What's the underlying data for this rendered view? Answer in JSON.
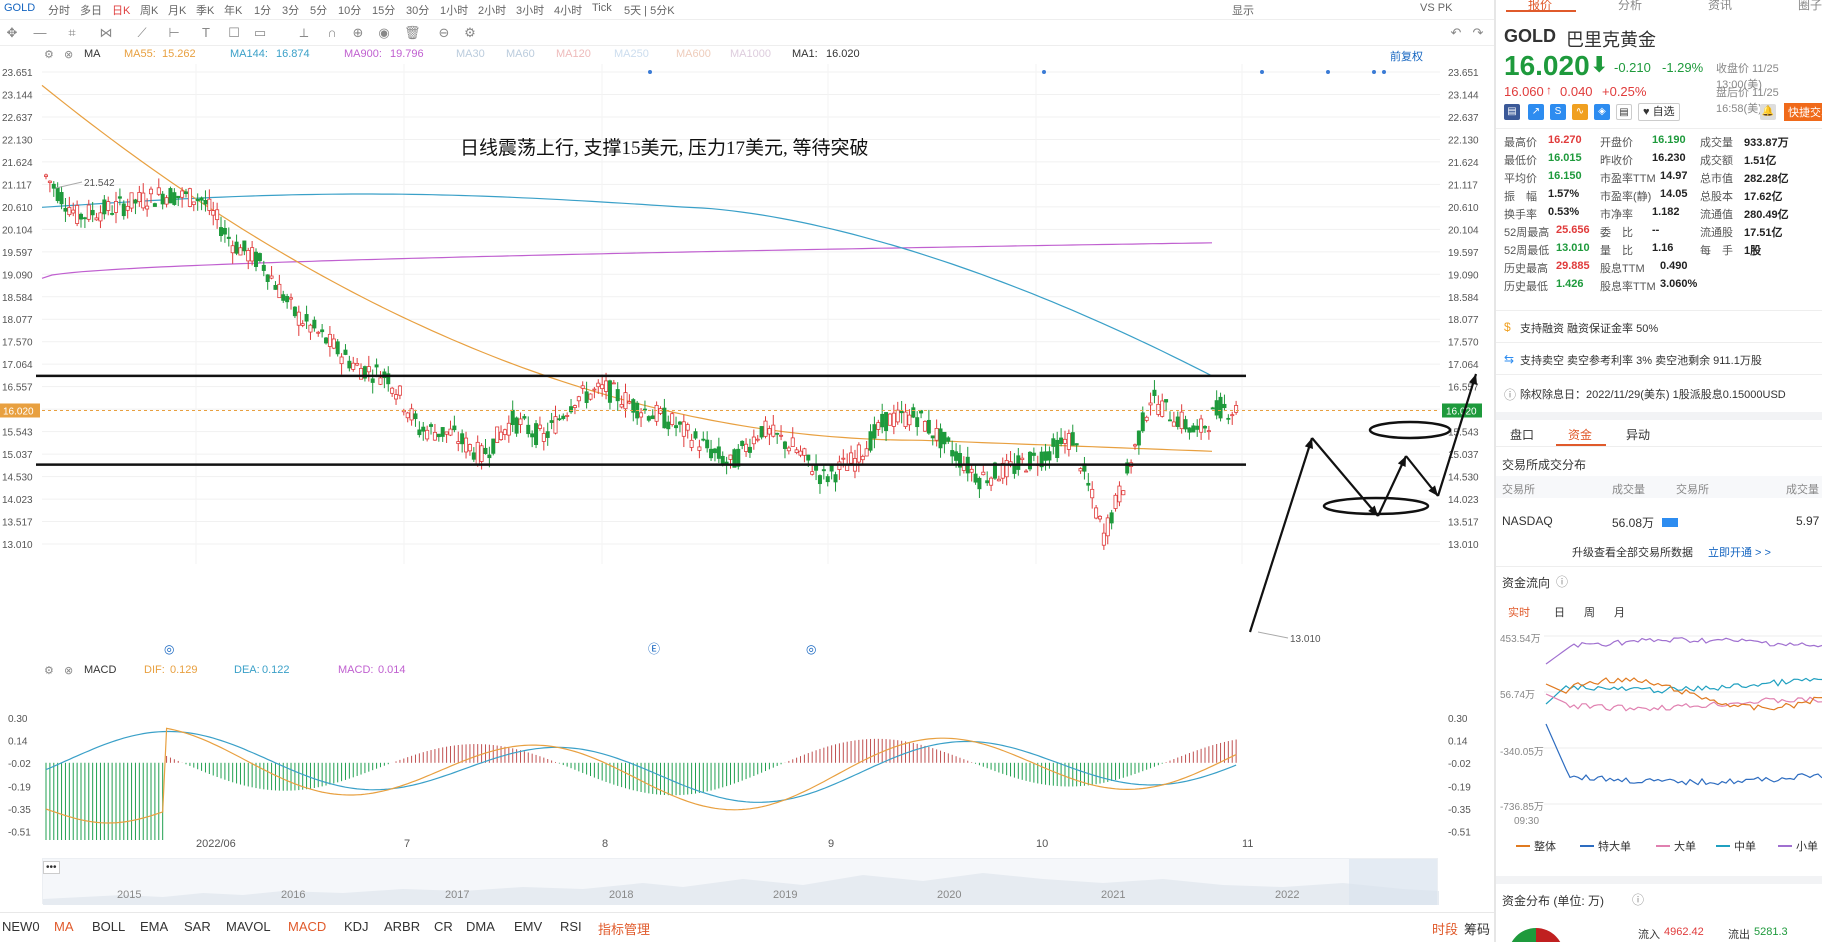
{
  "topbar": {
    "symbol": "GOLD",
    "periods": [
      "分时",
      "多日",
      "日K",
      "周K",
      "月K",
      "季K",
      "年K",
      "1分",
      "3分",
      "5分",
      "10分",
      "15分",
      "30分",
      "1小时",
      "2小时",
      "3小时",
      "4小时",
      "Tick",
      "5天 | 5分K"
    ],
    "active_period": "日K",
    "vs": "VS PK",
    "view": "显示"
  },
  "ma_legend": {
    "ma": "MA",
    "ma55_label": "MA55:",
    "ma55": "15.262",
    "ma144_label": "MA144:",
    "ma144": "16.874",
    "ma900_label": "MA900:",
    "ma900": "19.796",
    "faded": [
      "MA30",
      "MA60",
      "MA120",
      "MA250",
      "MA600",
      "MA1000"
    ],
    "ma1_label": "MA1:",
    "ma1": "16.020",
    "restore": "前复权"
  },
  "chart": {
    "annotation": "日线震荡上行, 支撑15美元, 压力17美元, 等待突破",
    "y_ticks": [
      "23.651",
      "23.144",
      "22.637",
      "22.130",
      "21.624",
      "21.117",
      "20.610",
      "20.104",
      "19.597",
      "19.090",
      "18.584",
      "18.077",
      "17.570",
      "17.064",
      "16.557",
      "16.050",
      "15.543",
      "15.037",
      "14.530",
      "14.023",
      "13.517",
      "13.010"
    ],
    "current_price": "16.020",
    "high_label": "21.542",
    "low_label": "13.010",
    "support": 14.8,
    "resistance": 16.8,
    "event_markers": [
      "◎",
      "Ⓔ",
      "◎"
    ]
  },
  "macd_legend": {
    "name": "MACD",
    "dif_label": "DIF:",
    "dif": "0.129",
    "dea_label": "DEA:",
    "dea": "0.122",
    "macd_label": "MACD:",
    "macd": "0.014"
  },
  "macd_axis": [
    "0.30",
    "0.14",
    "-0.02",
    "-0.19",
    "-0.35",
    "-0.51"
  ],
  "x_axis": [
    "2022/06",
    "7",
    "8",
    "9",
    "10",
    "11"
  ],
  "navigator_years": [
    "2015",
    "2016",
    "2017",
    "2018",
    "2019",
    "2020",
    "2021",
    "2022"
  ],
  "bottom_tabs": [
    "NEW0",
    "MA",
    "BOLL",
    "EMA",
    "SAR",
    "MAVOL",
    "MACD",
    "KDJ",
    "ARBR",
    "CR",
    "DMA",
    "EMV",
    "RSI",
    "指标管理"
  ],
  "bottom_right": [
    "时段",
    "筹码"
  ],
  "colors": {
    "up": "#e03b3b",
    "down": "#1e9a3c",
    "ma55": "#e8a040",
    "ma144": "#3aa0c8",
    "ma900": "#c060d0",
    "dif": "#e8a040",
    "dea": "#3aa0c8"
  },
  "right_panel": {
    "tabs": [
      "报价",
      "分析",
      "资讯",
      "圈子"
    ],
    "ticker": "GOLD",
    "name": "巴里克黄金",
    "price": "16.020",
    "change": "-0.210",
    "pct": "-1.29%",
    "close_info": "收盘价 11/25 13:00(美)",
    "after_price": "16.060",
    "after_change": "0.040",
    "after_pct": "+0.25%",
    "after_info": "盘后价 11/25 16:58(美)",
    "fav": "自选",
    "quick_trade": "快捷交易",
    "quote": [
      [
        "最高价",
        "16.270",
        "开盘价",
        "16.190",
        "成交量",
        "933.87万"
      ],
      [
        "最低价",
        "16.015",
        "昨收价",
        "16.230",
        "成交额",
        "1.51亿"
      ],
      [
        "平均价",
        "16.150",
        "市盈率TTM",
        "14.97",
        "总市值",
        "282.28亿"
      ],
      [
        "振　幅",
        "1.57%",
        "市盈率(静)",
        "14.05",
        "总股本",
        "17.62亿"
      ],
      [
        "换手率",
        "0.53%",
        "市净率",
        "1.182",
        "流通值",
        "280.49亿"
      ],
      [
        "52周最高",
        "25.656",
        "委　比",
        "--",
        "流通股",
        "17.51亿"
      ],
      [
        "52周最低",
        "13.010",
        "量　比",
        "1.16",
        "每　手",
        "1股"
      ],
      [
        "历史最高",
        "29.885",
        "股息TTM",
        "0.490",
        "",
        ""
      ],
      [
        "历史最低",
        "1.426",
        "股息率TTM",
        "3.060%",
        "",
        ""
      ]
    ],
    "margin": "支持融资  融资保证金率 50%",
    "short": "支持卖空  卖空参考利率 3%  卖空池剩余 911.1万股",
    "dividend": "除权除息日：2022/11/29(美东)  1股派股息0.15000USD",
    "sub_tabs": [
      "盘口",
      "资金",
      "异动"
    ],
    "exchange_title": "交易所成交分布",
    "exchange_headers": [
      "交易所",
      "成交量",
      "交易所",
      "成交量"
    ],
    "exchange_row": [
      "NASDAQ",
      "56.08万",
      "",
      "5.97"
    ],
    "upgrade": "升级查看全部交易所数据",
    "upgrade_link": "立即开通 > >",
    "flow_title": "资金流向",
    "flow_tabs": [
      "实时",
      "日",
      "周",
      "月"
    ],
    "flow_axis": [
      "453.54万",
      "56.74万",
      "-340.05万",
      "-736.85万"
    ],
    "flow_time": "09:30",
    "flow_legend": [
      "整体",
      "特大单",
      "大单",
      "中单",
      "小单"
    ],
    "dist_title": "资金分布 (单位: 万)",
    "inflow_label": "流入",
    "inflow": "4962.42",
    "outflow_label": "流出",
    "outflow": "5281.3"
  }
}
